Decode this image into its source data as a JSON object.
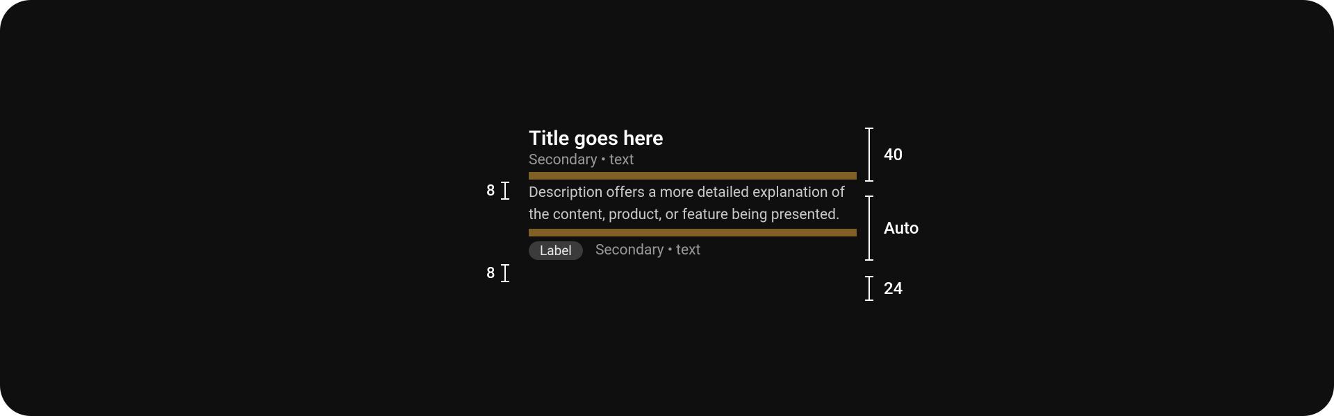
{
  "component": {
    "title": "Title goes here",
    "secondary1": "Secondary • text",
    "description": "Description offers a more detailed explanation of the content, product, or feature being presented.",
    "pill_label": "Label",
    "secondary2": "Secondary • text",
    "gap_color": "#806025"
  },
  "annotations": {
    "left_gap_1": "8",
    "left_gap_2": "8",
    "right_row1_height": "40",
    "right_row2_height": "Auto",
    "right_row3_height": "24"
  }
}
